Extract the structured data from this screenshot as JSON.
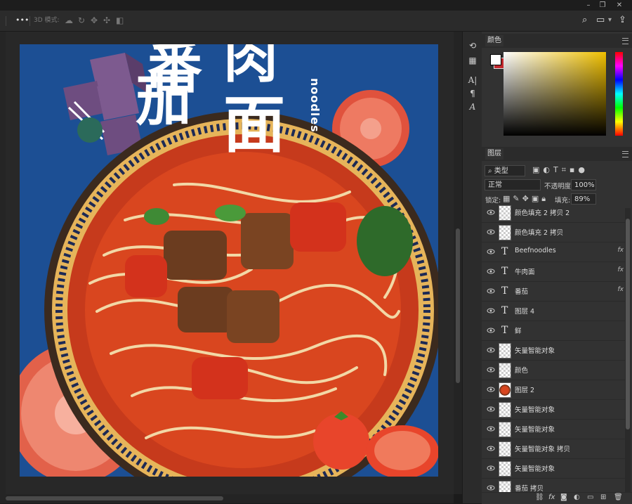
{
  "options_bar": {
    "more_icon": "•••",
    "mode_label": "3D 模式:",
    "mode_icons": [
      "orbit-3d-icon",
      "roll-3d-icon",
      "pan-3d-icon",
      "slide-3d-icon",
      "scale-3d-icon"
    ],
    "right_icons": [
      "search-icon",
      "workspace-icon",
      "settings-icon",
      "share-icon"
    ]
  },
  "window_controls": [
    "minimize",
    "restore",
    "close"
  ],
  "canvas": {
    "background": "#1c4f94",
    "title_chars": {
      "fan": "茄",
      "mian": "面",
      "niu_rou": "肉",
      "fan2": "番"
    },
    "vertical_text": "noodles"
  },
  "tool_column": [
    "3d-icon",
    "table-icon",
    "character-icon",
    "paragraph-icon",
    "glyph-icon"
  ],
  "color_panel": {
    "tab_label": "颜色",
    "foreground": "#ffffff",
    "background": "#c0272d"
  },
  "layers_panel": {
    "tab_label": "图层",
    "filter_value": "类型",
    "blend_mode": "正常",
    "opacity_label": "不透明度:",
    "opacity_value": "100%",
    "lock_label": "锁定:",
    "fill_label": "填充:",
    "fill_value": "89%",
    "layers": [
      {
        "name": "颜色填充 2 拷贝 2",
        "kind": "fill",
        "fx": false
      },
      {
        "name": "颜色填充 2 拷贝",
        "kind": "fill",
        "fx": false
      },
      {
        "name": "Beefnoodles",
        "kind": "text",
        "fx": true
      },
      {
        "name": "牛肉面",
        "kind": "text",
        "fx": true
      },
      {
        "name": "番茄",
        "kind": "text",
        "fx": true
      },
      {
        "name": "图层 4",
        "kind": "text",
        "fx": false
      },
      {
        "name": "鲜",
        "kind": "text",
        "fx": false
      },
      {
        "name": "矢量智能对象",
        "kind": "smart",
        "fx": false
      },
      {
        "name": "颜色",
        "kind": "smart",
        "fx": false
      },
      {
        "name": "图层 2",
        "kind": "image",
        "fx": false
      },
      {
        "name": "矢量智能对象",
        "kind": "smart",
        "fx": false
      },
      {
        "name": "矢量智能对象",
        "kind": "smart",
        "fx": false
      },
      {
        "name": "矢量智能对象 拷贝",
        "kind": "smart",
        "fx": false
      },
      {
        "name": "矢量智能对象",
        "kind": "smart",
        "fx": false
      },
      {
        "name": "番茄 拷贝",
        "kind": "smart",
        "fx": false
      }
    ],
    "fx_label": "fx",
    "footer_icons": [
      "link-layers-icon",
      "fx-icon",
      "mask-icon",
      "adjustment-icon",
      "group-icon",
      "new-layer-icon",
      "delete-icon"
    ]
  }
}
